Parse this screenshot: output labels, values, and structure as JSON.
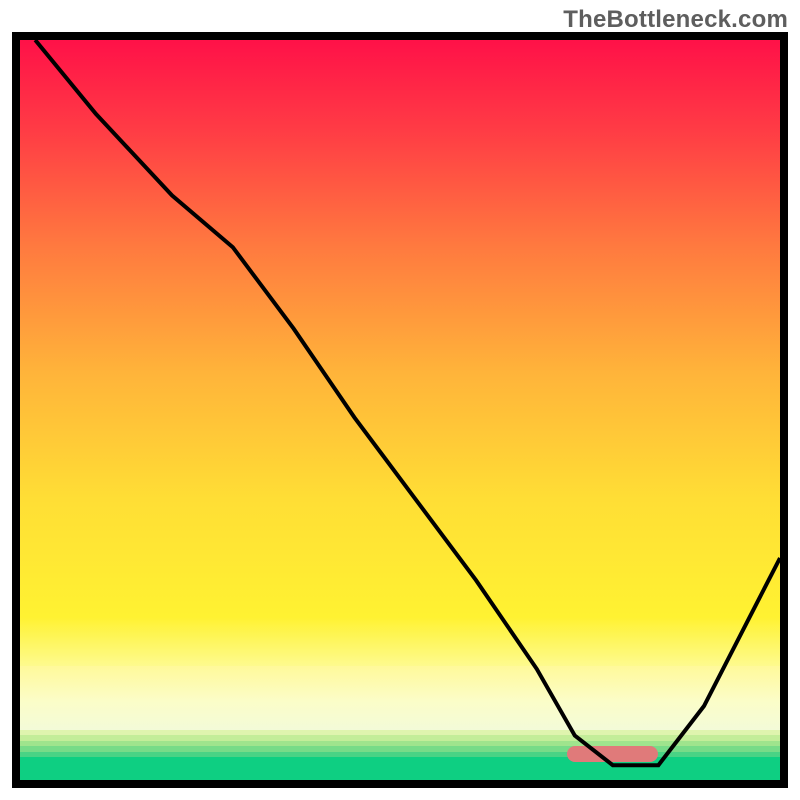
{
  "watermark": "TheBottleneck.com",
  "chart_data": {
    "type": "line",
    "title": "",
    "xlabel": "",
    "ylabel": "",
    "xlim": [
      0,
      100
    ],
    "ylim": [
      0,
      100
    ],
    "grid": false,
    "note": "Axes are unlabeled in the image; x and y are normalized 0–100. High y (top) = red zone, low y (bottom) = green zone. Curve reaches minimum (optimal) near x ≈ 78.",
    "series": [
      {
        "name": "curve",
        "x": [
          2,
          10,
          20,
          28,
          36,
          44,
          52,
          60,
          68,
          73,
          78,
          84,
          90,
          96,
          100
        ],
        "y": [
          100,
          90,
          79,
          72,
          61,
          49,
          38,
          27,
          15,
          6,
          2,
          2,
          10,
          22,
          30
        ]
      }
    ],
    "background_gradient": {
      "stops": [
        {
          "pos": 0.0,
          "color": "#ff1148"
        },
        {
          "pos": 0.12,
          "color": "#ff3b45"
        },
        {
          "pos": 0.28,
          "color": "#ff7a3f"
        },
        {
          "pos": 0.45,
          "color": "#ffb43a"
        },
        {
          "pos": 0.62,
          "color": "#ffde35"
        },
        {
          "pos": 0.78,
          "color": "#fff232"
        },
        {
          "pos": 0.86,
          "color": "#fdfca2"
        },
        {
          "pos": 0.91,
          "color": "#f7fbd0"
        },
        {
          "pos": 0.932,
          "color": "#d8f3a4"
        },
        {
          "pos": 0.944,
          "color": "#b6eb90"
        },
        {
          "pos": 0.955,
          "color": "#8fe288"
        },
        {
          "pos": 0.968,
          "color": "#5fd884"
        },
        {
          "pos": 1.0,
          "color": "#0ecf82"
        }
      ]
    },
    "optimal_marker": {
      "x_start": 72,
      "x_end": 84,
      "y": 2.5,
      "color": "#e07a7a"
    }
  }
}
